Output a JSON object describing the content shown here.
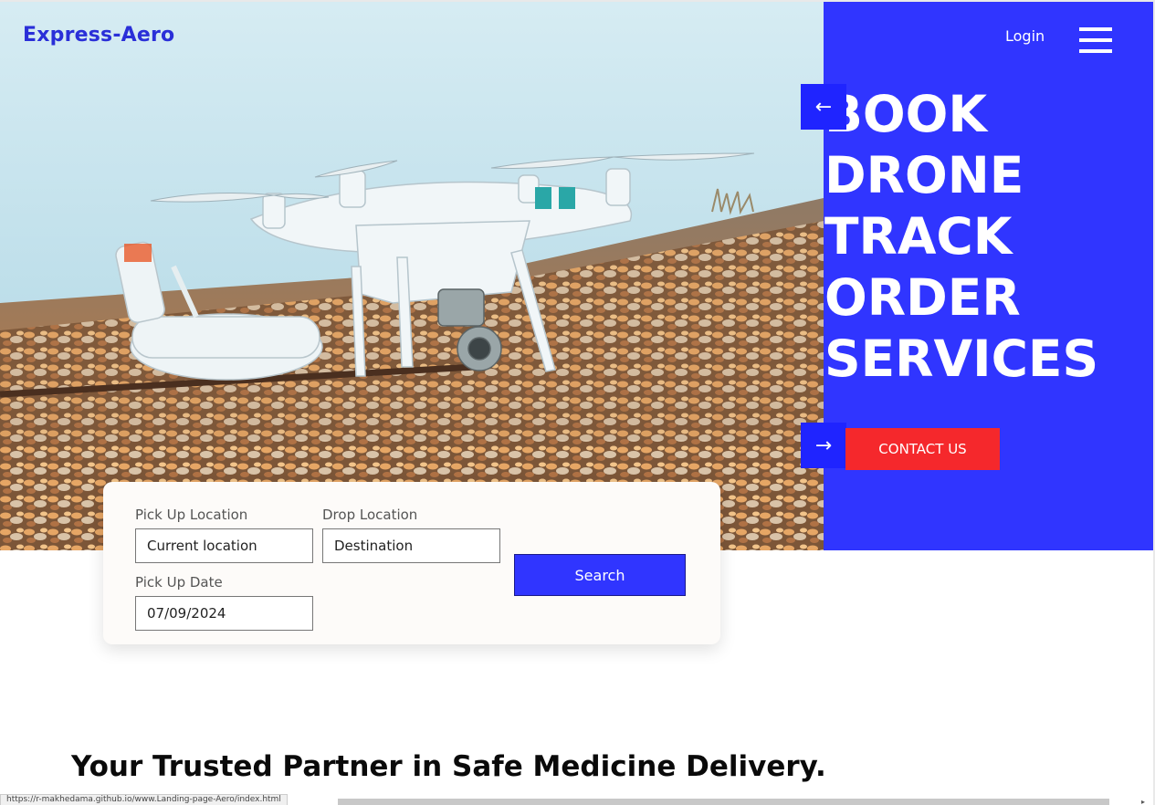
{
  "brand": {
    "logo": "Express-Aero",
    "accent": "#3035ff",
    "cta_color": "#f5282c"
  },
  "nav": {
    "login": "Login",
    "menu_icon": "hamburger-menu-icon"
  },
  "hero": {
    "headline": [
      "BOOK",
      "DRONE",
      "TRACK",
      "ORDER",
      "SERVICES"
    ],
    "prev_arrow": "←",
    "next_arrow": "→",
    "cta": "CONTACT US"
  },
  "booking": {
    "pickup_label": "Pick Up Location",
    "pickup_value": "Current location",
    "drop_label": "Drop Location",
    "drop_value": "Destination",
    "date_label": "Pick Up Date",
    "date_value": "07/09/2024",
    "search_label": "Search"
  },
  "section": {
    "tagline": "Your Trusted Partner in Safe Medicine Delivery."
  },
  "status_bar": {
    "url": "https://r-makhedama.github.io/www.Landing-page-Aero/index.html"
  }
}
